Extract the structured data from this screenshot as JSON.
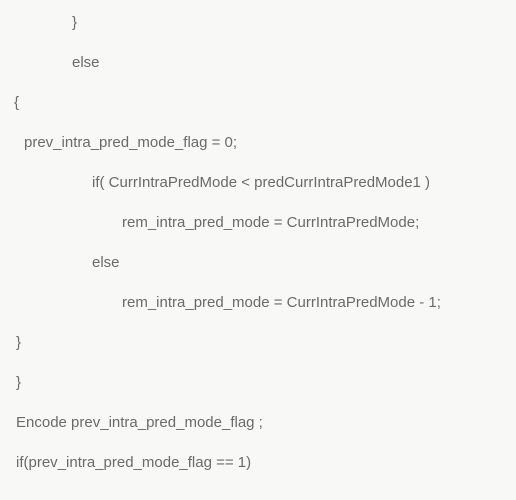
{
  "code": {
    "lines": [
      "}",
      "else",
      "{",
      "prev_intra_pred_mode_flag = 0;",
      "if( CurrIntraPredMode < predCurrIntraPredMode1 )",
      "rem_intra_pred_mode = CurrIntraPredMode;",
      "else",
      "rem_intra_pred_mode = CurrIntraPredMode - 1;",
      "}",
      "}",
      "Encode prev_intra_pred_mode_flag ;",
      "if(prev_intra_pred_mode_flag == 1)"
    ]
  }
}
